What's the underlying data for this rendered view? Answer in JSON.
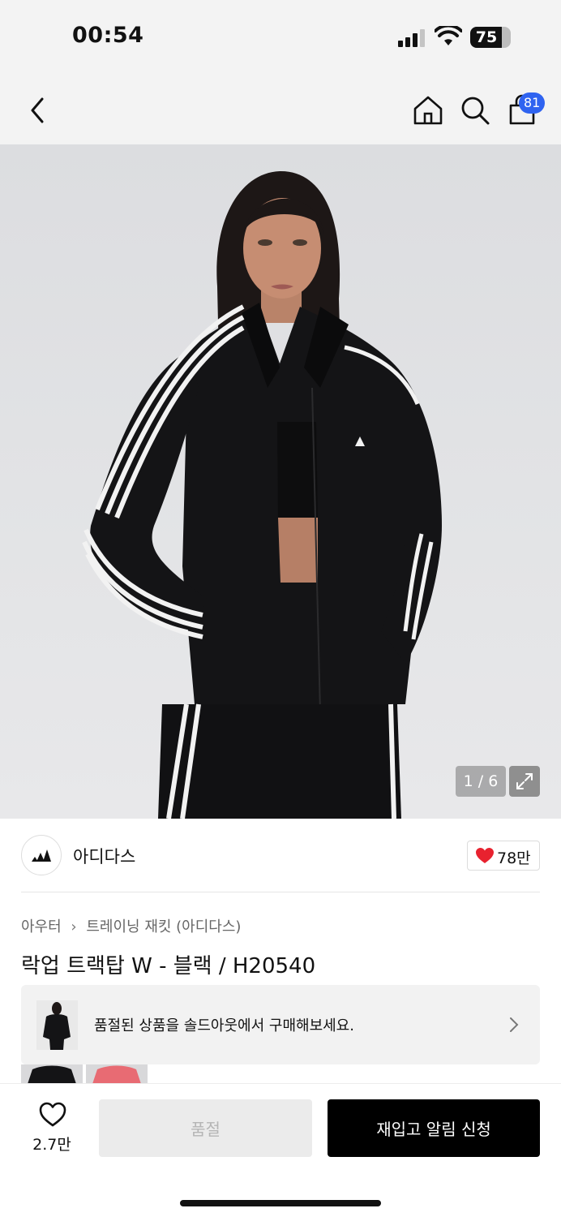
{
  "status_bar": {
    "time": "00:54",
    "battery": "75",
    "icons": [
      "signal-icon",
      "wifi-icon",
      "battery-icon"
    ]
  },
  "nav": {
    "icons": [
      "back-icon",
      "home-icon",
      "search-icon",
      "cart-icon"
    ],
    "cart_badge": "81"
  },
  "gallery": {
    "counter": "1 / 6",
    "expand_icon": "expand-icon"
  },
  "brand": {
    "name": "아디다스",
    "likes": "78만",
    "heart_color": "#e8222f"
  },
  "product": {
    "breadcrumb": [
      "아우터",
      "트레이닝 재킷 (아디다스)"
    ],
    "title": "락업 트랙탑 W - 블랙 / H20540"
  },
  "banner": {
    "text": "품절된 상품을 솔드아웃에서 구매해보세요."
  },
  "bottom": {
    "wish_count": "2.7만",
    "soldout_label": "품절",
    "restock_label": "재입고 알림 신청",
    "accent": "#000000"
  }
}
